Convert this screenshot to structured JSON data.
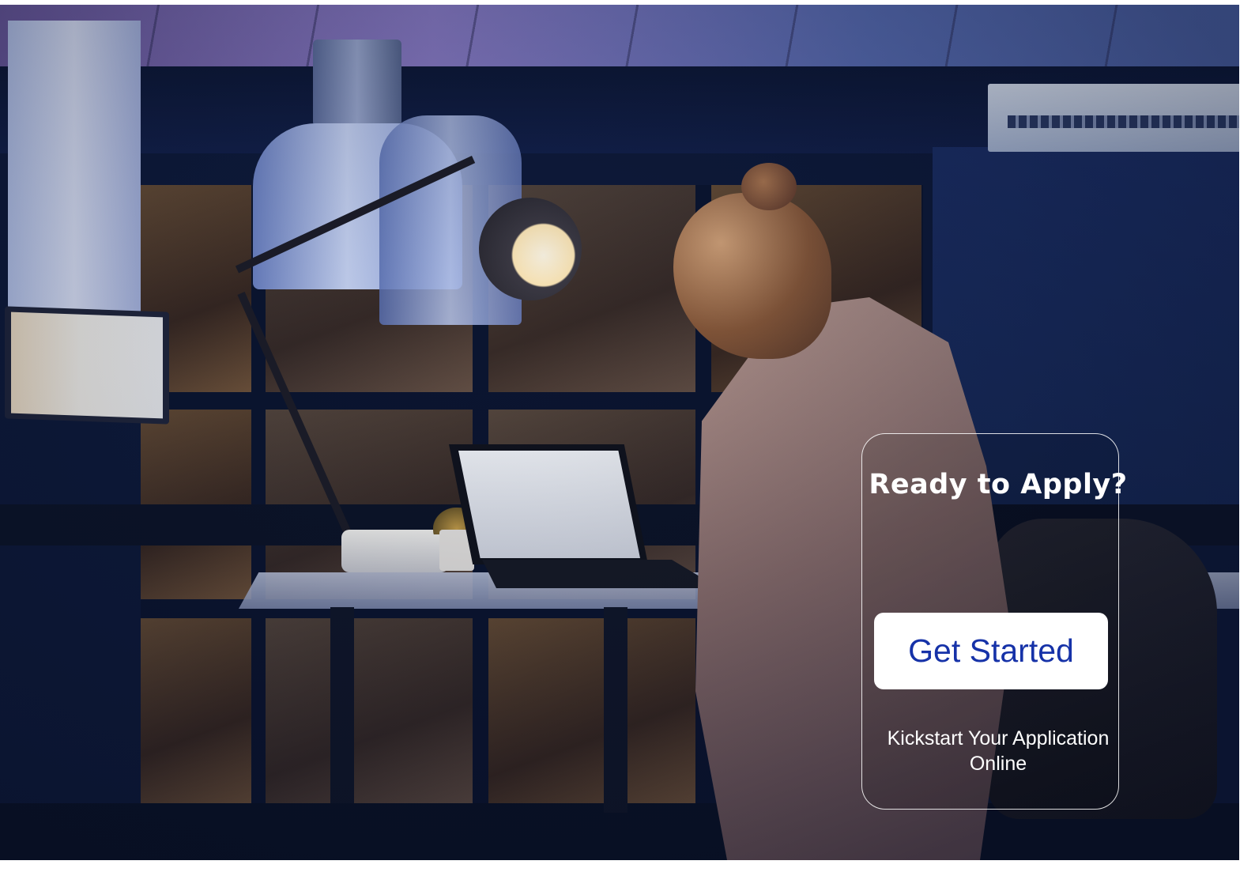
{
  "cta": {
    "title": "Ready to Apply?",
    "button_label": "Get Started",
    "subtitle": "Kickstart Your Application Online"
  },
  "colors": {
    "button_background": "#ffffff",
    "button_text": "#1632a8",
    "title_text": "#ffffff",
    "card_border": "#ffffff"
  }
}
